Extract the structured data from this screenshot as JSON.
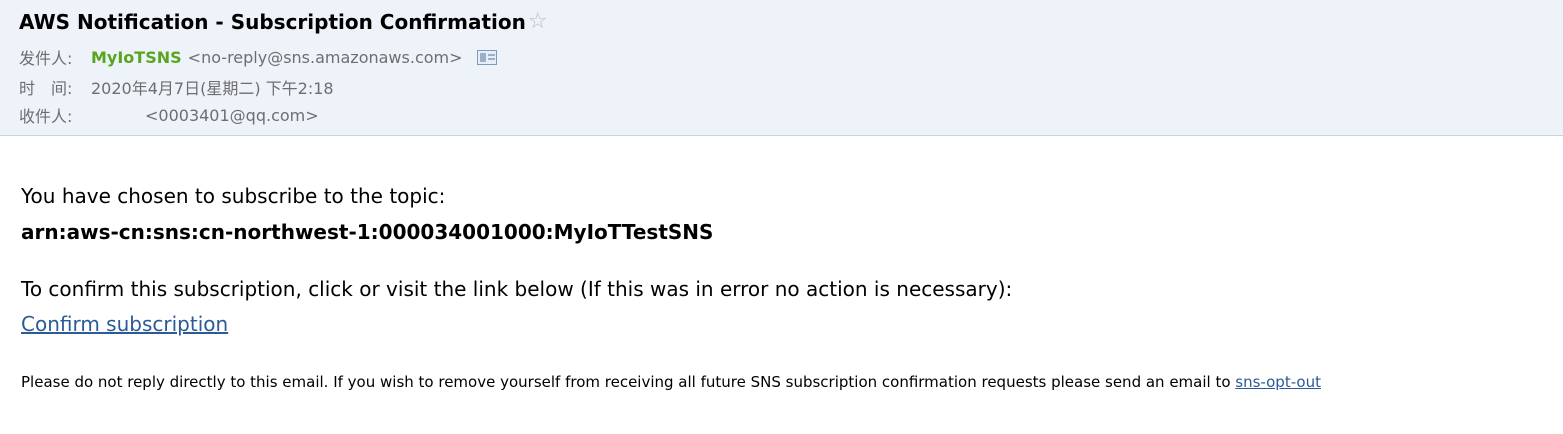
{
  "email": {
    "subject": "AWS Notification - Subscription Confirmation",
    "from_label": "发件人:",
    "sender_name": "MyIoTSNS",
    "sender_email": "<no-reply@sns.amazonaws.com>",
    "time_label": "时　间:",
    "time_value": "2020年4月7日(星期二) 下午2:18",
    "to_label": "收件人:",
    "recipient_email": "<0003401@qq.com>",
    "icons": {
      "star": "star-icon",
      "contact": "vcard-icon"
    }
  },
  "message": {
    "intro": "You have chosen to subscribe to the topic:",
    "topic_arn": "arn:aws-cn:sns:cn-northwest-1:000034001000:MyIoTTestSNS",
    "confirm_instruction": "To confirm this subscription, click or visit the link below (If this was in error no action is necessary):",
    "confirm_link": "Confirm subscription",
    "footer_text": "Please do not reply directly to this email. If you wish to remove yourself from receiving all future SNS subscription confirmation requests please send an email to ",
    "opt_out_link": "sns-opt-out"
  },
  "colors": {
    "header_bg": "#eef3fa",
    "sender_green": "#5aa51f",
    "link_blue": "#2b5a96",
    "meta_gray": "#6e6e6e"
  }
}
